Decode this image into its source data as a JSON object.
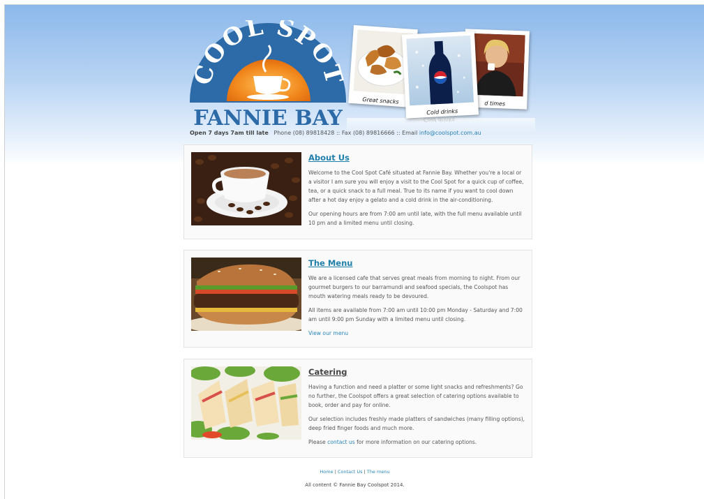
{
  "logo": {
    "top_text": "COOL SPOT",
    "bottom_text": "FANNIE BAY"
  },
  "photos": [
    {
      "caption": "Great snacks"
    },
    {
      "caption": "Cold drinks"
    },
    {
      "caption": "d times"
    }
  ],
  "header": {
    "reflection_text": "Cold drinks",
    "hours": "Open 7 days 7am till late",
    "phone": "Phone (08) 89818428",
    "separator": "::",
    "fax": "Fax (08) 89816666",
    "email_label": "Email",
    "email": "info@coolspot.com.au"
  },
  "sections": {
    "about": {
      "title": "About Us",
      "paragraphs": [
        "Welcome to the Cool Spot Café situated at Fannie Bay. Whether you're a local or a visitor I am sure you will enjoy a visit to the Cool Spot for a quick cup of coffee, tea, or a quick snack to a full meal. True to its name if you want to cool down after a hot day enjoy a gelato and a cold drink in the air-conditioning.",
        "Our opening hours are from 7:00 am until late, with the full menu available until 10 pm and a limited menu until closing."
      ]
    },
    "menu": {
      "title": "The Menu",
      "paragraphs": [
        "We are a licensed cafe that serves great meals from morning to night. From our gourmet burgers to our barramundi and seafood specials, the Coolspot has mouth watering meals ready to be devoured.",
        "All items are available from 7:00 am until 10:00 pm Monday - Saturday and 7:00 am until 9:00 pm Sunday with a limited menu until closing."
      ],
      "link": "View our menu"
    },
    "catering": {
      "title": "Catering",
      "paragraphs": [
        "Having a function and need a platter or some light snacks and refreshments? Go no further, the Coolspot offers a great selection of catering options available to book, order and pay for online.",
        "Our selection includes freshly made platters of sandwiches (many filling options), deep fried finger foods and much more."
      ],
      "contact_prefix": "Please",
      "contact_link": "contact us",
      "contact_suffix": "for more information on our catering options."
    }
  },
  "footer": {
    "links": [
      "Home",
      "Contact Us",
      "The menu"
    ],
    "separator": "|",
    "copyright": "All content © Fannie Bay Coolspot 2014."
  },
  "colors": {
    "logo_blue": "#2c6aa8",
    "logo_orange": "#f08a1c",
    "link_blue": "#2a86b8",
    "heading_blue": "#1f7fab"
  }
}
